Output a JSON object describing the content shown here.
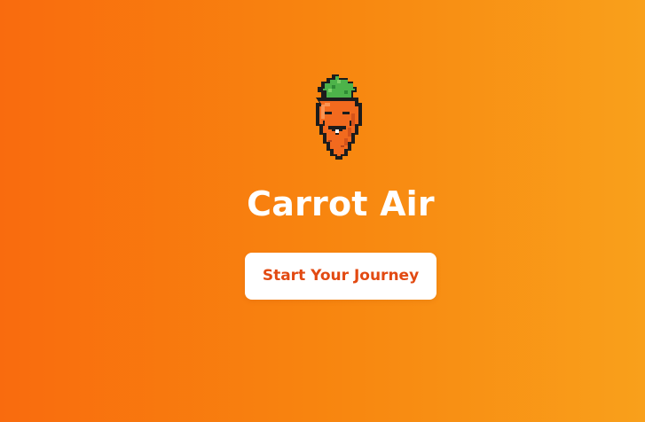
{
  "app": {
    "title": "Carrot Air",
    "logo_icon": "pixel-carrot-mascot-icon"
  },
  "cta": {
    "label": "Start Your Journey"
  },
  "colors": {
    "background_start": "#f96b0e",
    "background_end": "#f9a01b",
    "title_text": "#ffffff",
    "button_bg": "#ffffff",
    "button_text": "#e24a12",
    "carrot_body": "#f26a1e",
    "carrot_leaves": "#4db34a",
    "outline": "#1c1c1c"
  }
}
